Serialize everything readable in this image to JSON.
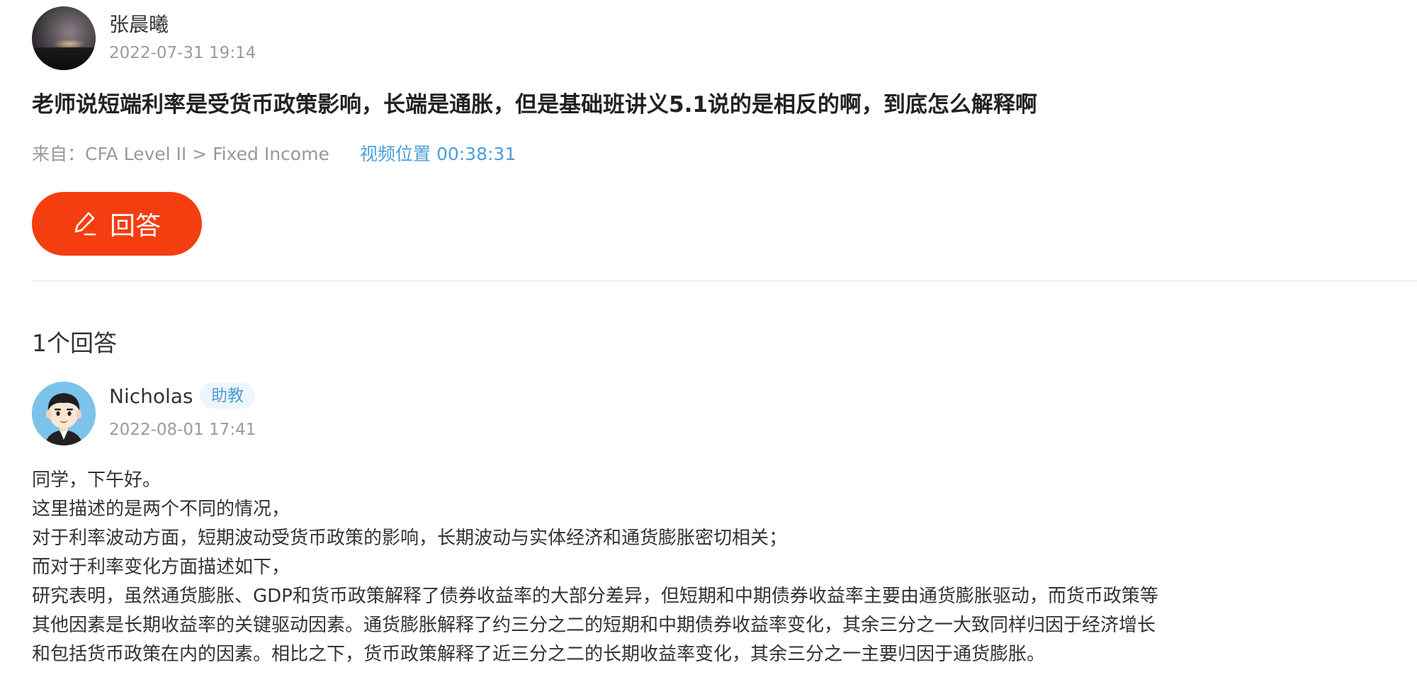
{
  "question": {
    "author": "张晨曦",
    "timestamp": "2022-07-31 19:14",
    "title": "老师说短端利率是受货币政策影响，长端是通胀，但是基础班讲义5.1说的是相反的啊，到底怎么解释啊",
    "source": "来自：CFA Level II > Fixed Income",
    "video_position": "视频位置 00:38:31"
  },
  "answer_button": {
    "label": "回答",
    "icon": "pencil-icon",
    "color": "#f43e0f"
  },
  "answers_section": {
    "count_label": "1个回答",
    "answers": [
      {
        "author": "Nicholas",
        "role_badge": "助教",
        "timestamp": "2022-08-01 17:41",
        "lines": [
          "同学，下午好。",
          "这里描述的是两个不同的情况，",
          "对于利率波动方面，短期波动受货币政策的影响，长期波动与实体经济和通货膨胀密切相关；",
          "而对于利率变化方面描述如下，",
          "研究表明，虽然通货膨胀、GDP和货币政策解释了债券收益率的大部分差异，但短期和中期债券收益率主要由通货膨胀驱动，而货币政策等",
          "其他因素是长期收益率的关键驱动因素。通货膨胀解释了约三分之二的短期和中期债券收益率变化，其余三分之一大致同样归因于经济增长",
          "和包括货币政策在内的因素。相比之下，货币政策解释了近三分之二的长期收益率变化，其余三分之一主要归因于通货膨胀。"
        ]
      }
    ]
  },
  "colors": {
    "accent_orange": "#f43e0f",
    "link_blue": "#4a9fd8",
    "muted_gray": "#9b9b9b"
  }
}
